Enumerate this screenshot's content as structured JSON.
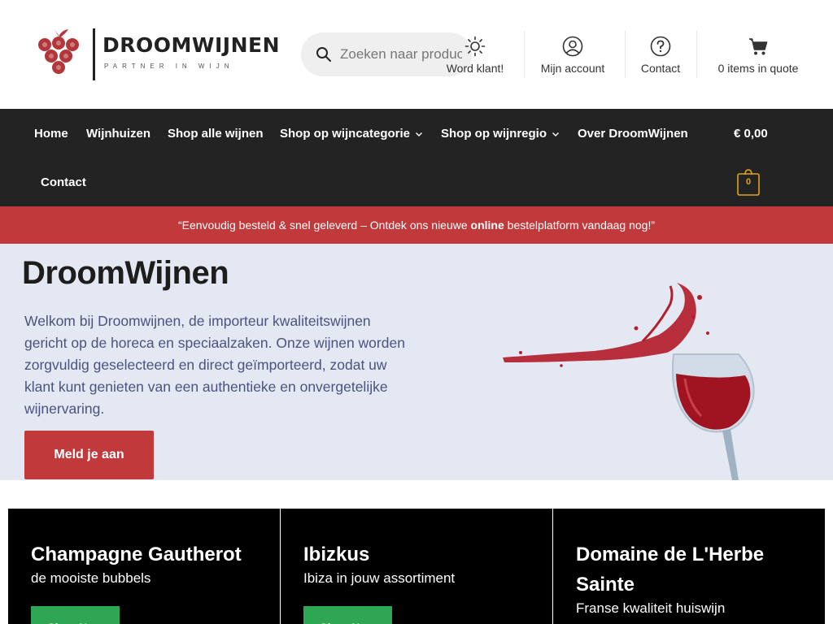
{
  "brand": {
    "name": "DROOMWIJNEN",
    "tagline": "PARTNER IN WIJN",
    "color": "#c0393b"
  },
  "search": {
    "placeholder": "Zoeken naar producten…",
    "icon": "search-icon"
  },
  "header_links": [
    {
      "label": "Word klant!",
      "icon": "sun-icon"
    },
    {
      "label": "Mijn account",
      "icon": "user-icon"
    },
    {
      "label": "Contact",
      "icon": "help-icon"
    },
    {
      "label": "0 items in quote",
      "icon": "cart-icon"
    }
  ],
  "nav": {
    "items": [
      {
        "label": "Home"
      },
      {
        "label": "Wijnhuizen"
      },
      {
        "label": "Shop alle wijnen"
      },
      {
        "label": "Shop op wijncategorie"
      },
      {
        "label": "Shop op wijnregio"
      },
      {
        "label": "Over DroomWijnen"
      },
      {
        "label": "Contact"
      }
    ],
    "cart_total": "€ 0,00",
    "cart_count": "0"
  },
  "banner": {
    "before": "“Eenvoudig besteld & snel geleverd – Ontdek ons nieuwe ",
    "bold": "online",
    "after": " bestelplatform vandaag nog!”"
  },
  "hero": {
    "title": "DroomWijnen",
    "text": "Welkom bij Droomwijnen, de importeur kwaliteitswijnen gericht op de horeca en speciaalzaken. Onze wijnen worden zorgvuldig geselecteerd en direct geïmporteerd, zodat uw klant kunt genieten van een authentieke en onvergetelijke wijnervaring.",
    "button": "Meld je aan"
  },
  "cards": [
    {
      "title": "Champagne Gautherot",
      "subtitle": "de mooiste bubbels",
      "button": "Shop Now"
    },
    {
      "title": "Ibizkus",
      "subtitle": "Ibiza in jouw assortiment",
      "button": "Shop Now"
    },
    {
      "title": "Domaine de L'Herbe Sainte",
      "subtitle": "Franse kwaliteit huiswijn",
      "button": "Shop Now"
    }
  ],
  "colors": {
    "nav_bg": "#232323",
    "banner_bg": "#c0393b",
    "hero_bg": "#e4e8f2",
    "card_bg": "#000000",
    "card_button": "#2fa653",
    "cart_badge": "#e0a31a"
  }
}
